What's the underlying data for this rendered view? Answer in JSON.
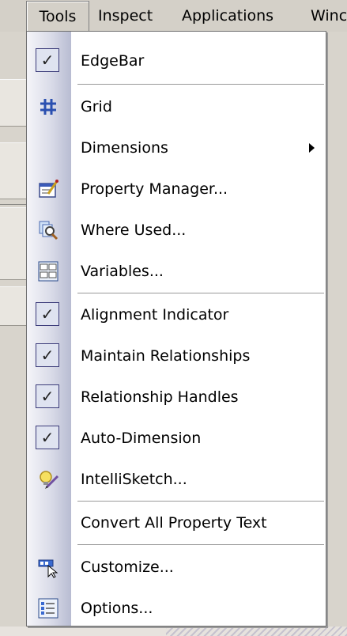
{
  "menubar": {
    "items": [
      "Tools",
      "Inspect",
      "Applications",
      "Winc"
    ]
  },
  "menu": {
    "items": [
      {
        "label": "EdgeBar",
        "checked": true
      },
      {
        "label": "Grid",
        "icon": "grid-icon"
      },
      {
        "label": "Dimensions",
        "submenu": true
      },
      {
        "label": "Property Manager...",
        "icon": "property-manager-icon"
      },
      {
        "label": "Where Used...",
        "icon": "where-used-icon"
      },
      {
        "label": "Variables...",
        "icon": "variables-icon"
      },
      {
        "label": "Alignment Indicator",
        "checked": true
      },
      {
        "label": "Maintain Relationships",
        "checked": true
      },
      {
        "label": "Relationship Handles",
        "checked": true
      },
      {
        "label": "Auto-Dimension",
        "checked": true
      },
      {
        "label": "IntelliSketch...",
        "icon": "intellisketch-icon"
      },
      {
        "label": "Convert All Property Text"
      },
      {
        "label": "Customize...",
        "icon": "customize-icon"
      },
      {
        "label": "Options...",
        "icon": "options-icon"
      }
    ]
  },
  "colors": {
    "menu_bg": "#ffffff",
    "gutter": "#c6c9dc",
    "chrome": "#d4d0c8",
    "check_border": "#3c3c7a"
  }
}
